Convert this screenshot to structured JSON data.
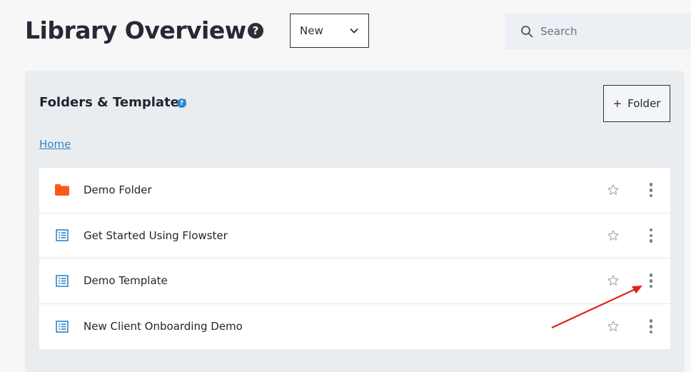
{
  "header": {
    "title": "Library Overview",
    "help_glyph": "?",
    "new_select": {
      "value": "New"
    },
    "search": {
      "placeholder": "Search"
    }
  },
  "panel": {
    "title": "Folders & Templates",
    "help_glyph": "?",
    "folder_button": {
      "plus": "+",
      "label": "Folder"
    },
    "breadcrumb": "Home",
    "items": [
      {
        "label": "Demo Folder",
        "icon": "folder-icon"
      },
      {
        "label": "Get Started Using Flowster",
        "icon": "template-icon"
      },
      {
        "label": "Demo Template",
        "icon": "template-icon"
      },
      {
        "label": "New Client Onboarding Demo",
        "icon": "template-icon"
      }
    ]
  },
  "colors": {
    "folder": "#fa5a17",
    "template": "#2f86c6",
    "link": "#2f86c6",
    "annotation_arrow": "#e3201b",
    "panel_bg": "#eaedf0"
  }
}
